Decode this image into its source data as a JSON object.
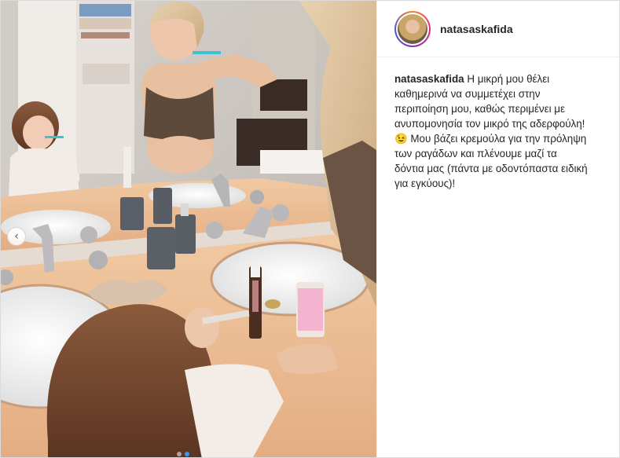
{
  "post": {
    "author": {
      "username": "natasaskafida"
    },
    "caption": {
      "username": "natasaskafida",
      "lines": [
        "Η μικρή μου θέλει",
        "καθημερινά να συμμετέχει στην",
        "περιποίηση μου, καθώς περιμένει με",
        "ανυπομονησία τον μικρό της αδερφούλη!",
        "😉 Μου βάζει κρεμούλα για την πρόληψη",
        "των ραγάδων και πλένουμε μαζί τα",
        "δόντια μας (πάντα με οδοντόπαστα ειδική",
        "για εγκύους)!"
      ]
    },
    "carousel": {
      "prev_icon": "‹",
      "slide_count": 2,
      "active_slide": 2
    }
  }
}
